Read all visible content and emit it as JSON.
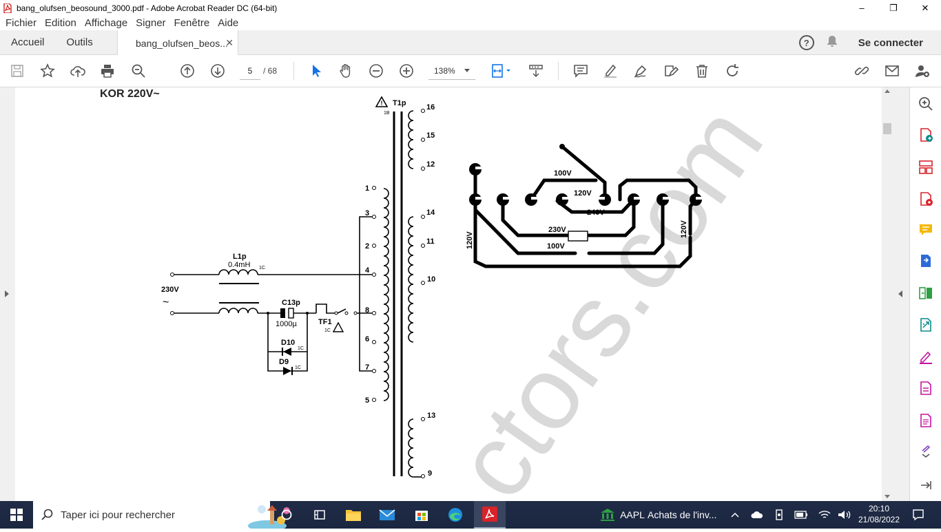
{
  "window": {
    "title": "bang_olufsen_beosound_3000.pdf - Adobe Acrobat Reader DC (64-bit)",
    "controls": {
      "minimize": "–",
      "restore": "❐",
      "close": "✕"
    }
  },
  "menu": [
    "Fichier",
    "Edition",
    "Affichage",
    "Signer",
    "Fenêtre",
    "Aide"
  ],
  "tabs": {
    "home": "Accueil",
    "tools": "Outils",
    "document": "bang_olufsen_beos...",
    "close": "✕",
    "help": "?",
    "signin": "Se connecter"
  },
  "toolbar": {
    "page_current": "5",
    "page_total": "/ 68",
    "zoom": "138%"
  },
  "schematic": {
    "heading": "KOR 220V~",
    "transformer": "T1p",
    "transformer_sub": "1B",
    "pins_secondary_top": [
      "16",
      "15",
      "12"
    ],
    "pins_primary": [
      "1",
      "3",
      "2",
      "4",
      "8",
      "6",
      "7",
      "5"
    ],
    "pins_secondary_mid": [
      "14",
      "11",
      "10"
    ],
    "pins_secondary_bottom": [
      "13",
      "9"
    ],
    "inductor": "L1p",
    "inductor_value": "0.4mH",
    "inductor_sub": "1C",
    "mains": "230V",
    "mains_symbol": "~",
    "capacitor": "C13p",
    "capacitor_value": "1000µ",
    "fuse": "TF1",
    "fuse_sub": "1C",
    "diode1": "D10",
    "diode1_sub": "1C",
    "diode2": "D9",
    "diode2_sub": "1C",
    "selector_labels": {
      "v100_top": "100V",
      "v120_mid": "120V",
      "v240": "240V",
      "v230": "230V",
      "v100_bottom": "100V",
      "v120_left": "120V",
      "v120_right": "120V"
    },
    "watermark": "ctors.com"
  },
  "taskbar": {
    "search_placeholder": "Taper ici pour rechercher",
    "stock": "AAPL",
    "stock_text": "Achats de l'inv...",
    "time": "20:10",
    "date": "21/08/2022"
  }
}
